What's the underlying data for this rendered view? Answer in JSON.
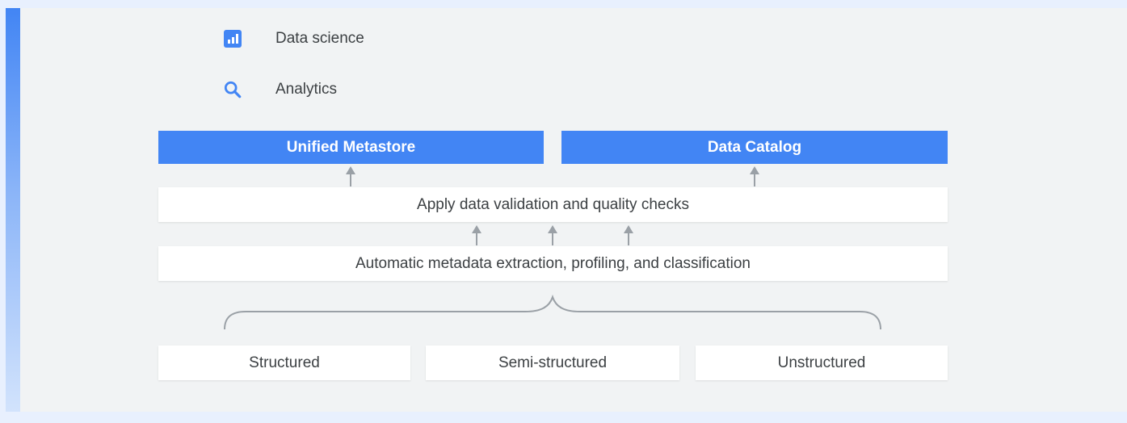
{
  "legend": {
    "data_science": {
      "label": "Data science",
      "icon": "bar-chart-icon"
    },
    "analytics": {
      "label": "Analytics",
      "icon": "search-icon"
    }
  },
  "targets": {
    "unified_metastore": "Unified Metastore",
    "data_catalog": "Data Catalog"
  },
  "steps": {
    "validation": "Apply data validation and quality checks",
    "extraction": "Automatic metadata extraction, profiling, and classification"
  },
  "sources": [
    "Structured",
    "Semi-structured",
    "Unstructured"
  ],
  "colors": {
    "accent": "#4285f4",
    "arrow": "#9aa0a6",
    "text": "#3c4043",
    "panel": "#f1f3f4",
    "box": "#ffffff"
  }
}
